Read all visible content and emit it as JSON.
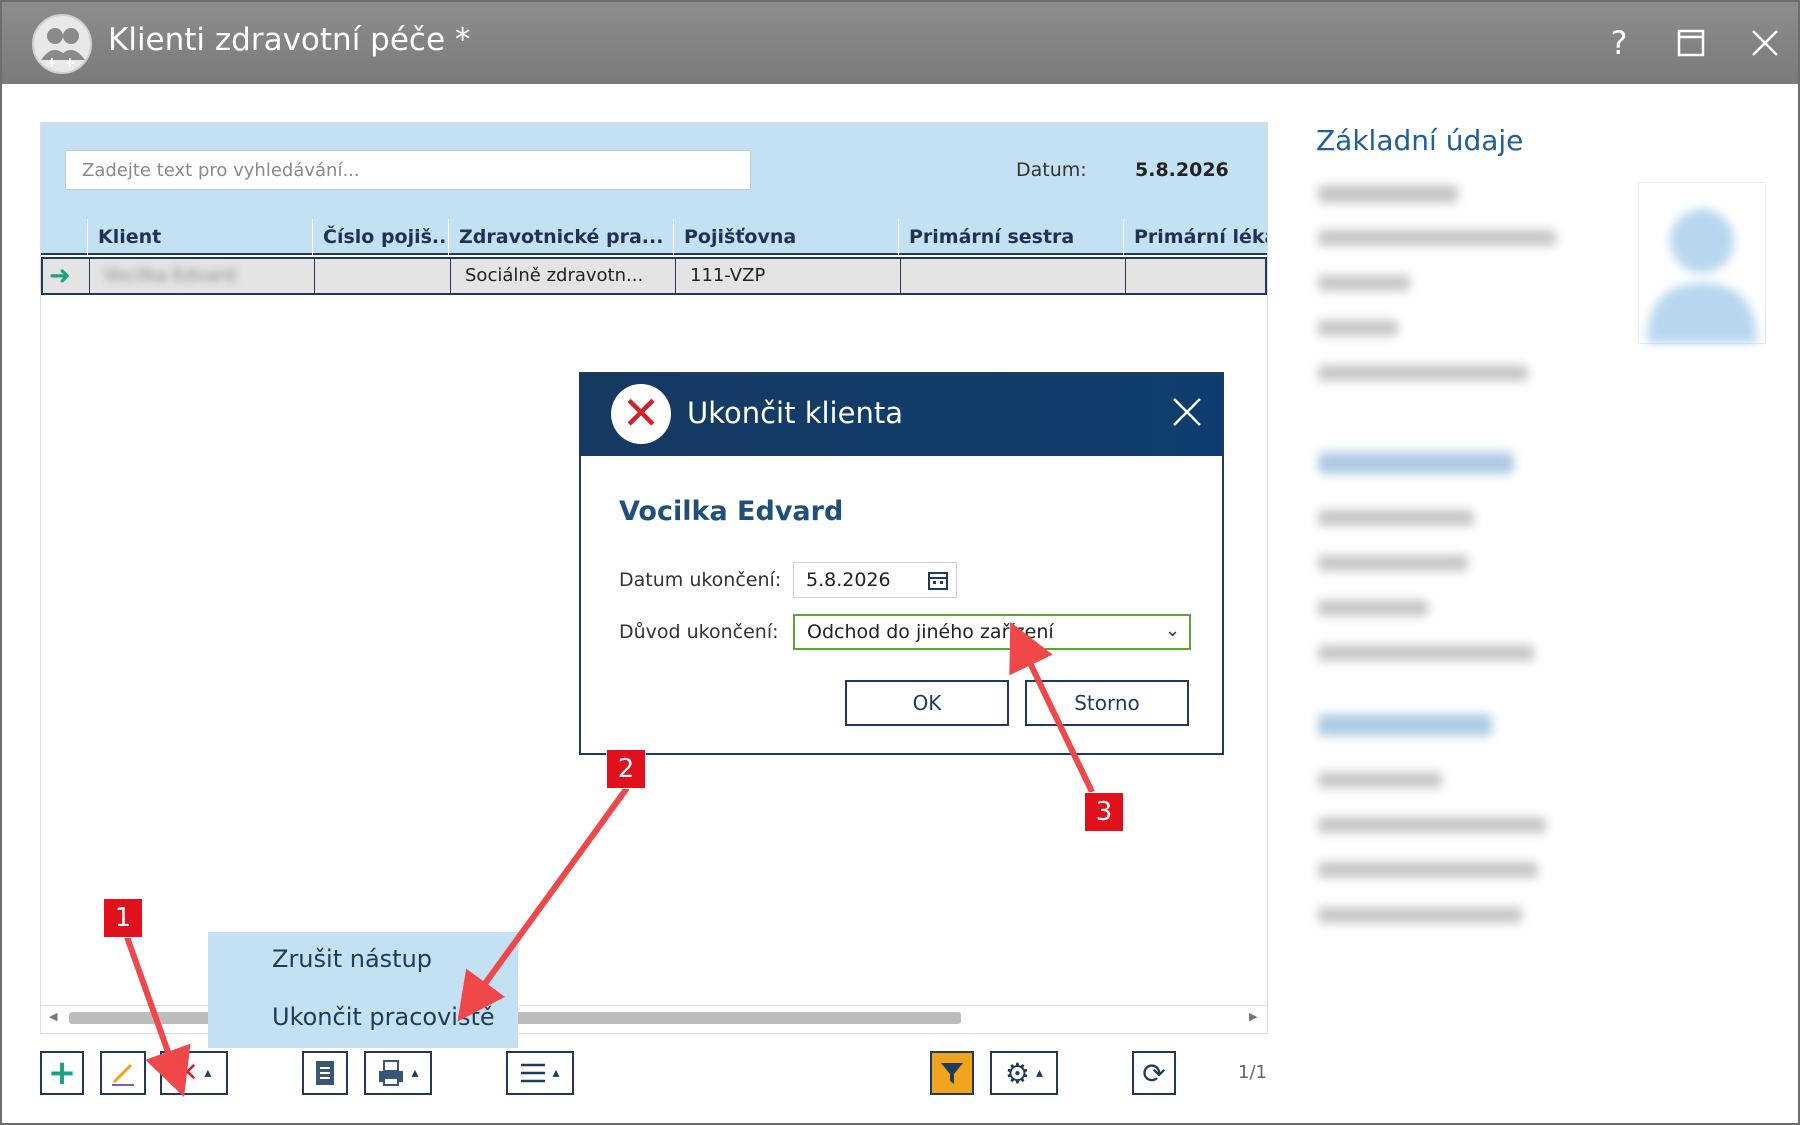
{
  "window": {
    "title": "Klienti zdravotní péče *",
    "help": "?",
    "maximize": "☐",
    "close": "✕"
  },
  "search": {
    "placeholder": "Zadejte text pro vyhledávání..."
  },
  "datum": {
    "label": "Datum:",
    "value": "5.8.2026"
  },
  "grid": {
    "columns": [
      "Klient",
      "Číslo pojiš...",
      "Zdravotnické pra... ↑",
      "Pojišťovna",
      "Primární sestra",
      "Primární léka"
    ],
    "row": {
      "klient": "Vocilka Edvard",
      "cislo": "",
      "zdravotnicke": "Sociálně zdravotn...",
      "pojistovna": "111-VZP",
      "sestra": "",
      "lekar": ""
    }
  },
  "popup": {
    "items": [
      "Zrušit nástup",
      "Ukončit pracoviště"
    ]
  },
  "toolbar": {
    "page_count": "1/1",
    "add": "+",
    "caret": "▴"
  },
  "right_panel": {
    "title": "Základní údaje"
  },
  "dialog": {
    "title": "Ukončit klienta",
    "icon": "✕",
    "close": "✕",
    "client_name": "Vocilka Edvard",
    "date_label": "Datum ukončení:",
    "date_value": "5.8.2026",
    "reason_label": "Důvod ukončení:",
    "reason_value": "Odchod do jiného zařízení",
    "ok": "OK",
    "cancel": "Storno"
  },
  "annotations": [
    "1",
    "2",
    "3"
  ],
  "colors": {
    "accent": "#1f3a5a",
    "header_blue": "#c3e1f3",
    "dialog_blue": "#143a62",
    "annotation_red": "#e0101c",
    "filter_orange": "#f0a41e",
    "select_green": "#5aa630"
  }
}
